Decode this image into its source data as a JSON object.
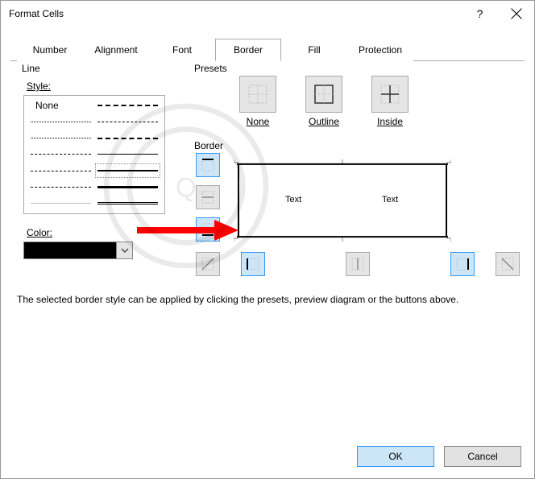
{
  "title": "Format Cells",
  "tabs": [
    "Number",
    "Alignment",
    "Font",
    "Border",
    "Fill",
    "Protection"
  ],
  "active_tab": "Border",
  "line": {
    "group": "Line",
    "style_label": "Style:",
    "none": "None",
    "color_label": "Color:",
    "color_value": "#000000"
  },
  "presets": {
    "group": "Presets",
    "items": [
      "None",
      "Outline",
      "Inside"
    ]
  },
  "border": {
    "group": "Border",
    "preview_text_left": "Text",
    "preview_text_right": "Text"
  },
  "hint": "The selected border style can be applied by clicking the presets, preview diagram or the buttons above.",
  "buttons": {
    "ok": "OK",
    "cancel": "Cancel"
  }
}
